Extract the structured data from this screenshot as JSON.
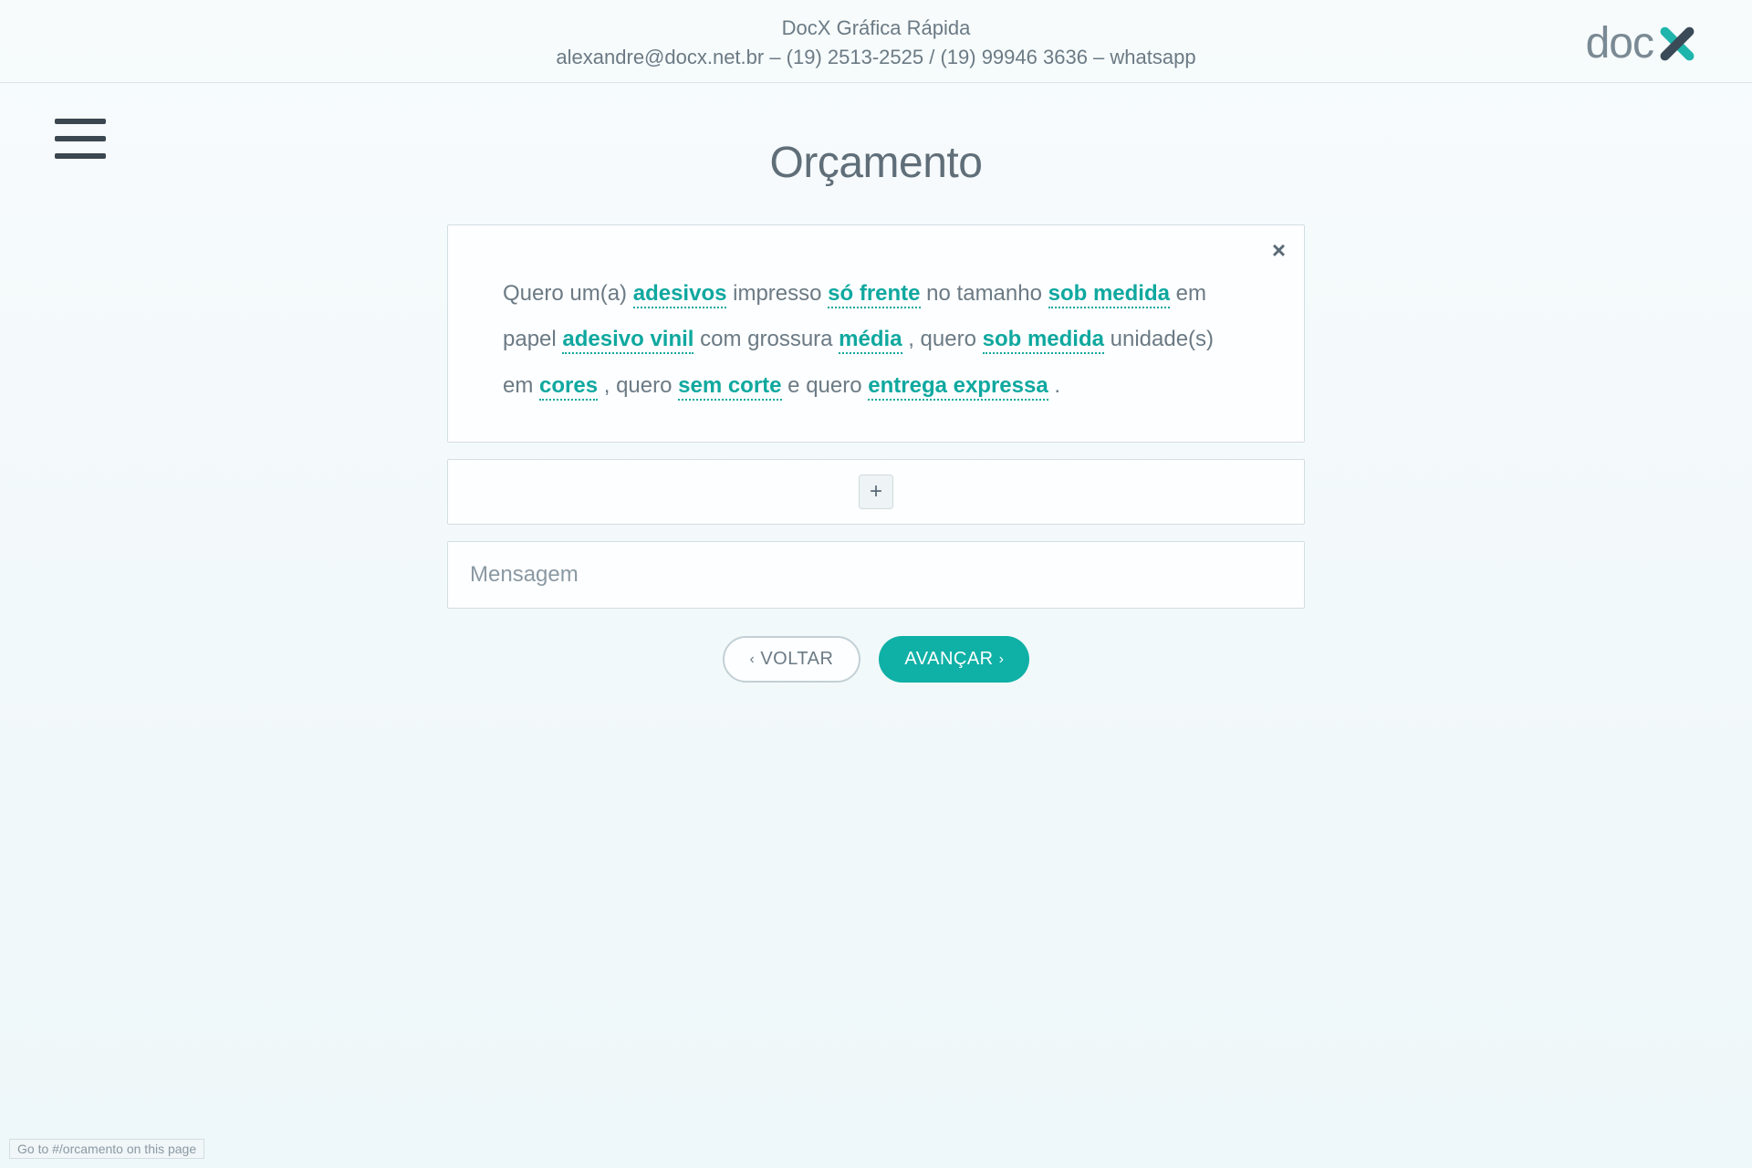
{
  "logo_text": "doc",
  "header": {
    "line1": "DocX Gráfica Rápida",
    "line2": "alexandre@docx.net.br – (19) 2513-2525 / (19) 99946 3636 – whatsapp"
  },
  "page_title": "Orçamento",
  "sentence": {
    "t0": "Quero um(a) ",
    "opt_product": "adesivos",
    "t1": " impresso ",
    "opt_sides": "só frente",
    "t2": " no tamanho ",
    "opt_size": "sob medida",
    "t3": " em papel ",
    "opt_paper": "adesivo vinil",
    "t4": " com grossura ",
    "opt_thickness": "média",
    "t5": " , quero ",
    "opt_qty": "sob medida",
    "t6": " unidade(s) em ",
    "opt_color": "cores",
    "t7": " , quero ",
    "opt_cut": "sem corte",
    "t8": " e quero ",
    "opt_delivery": "entrega expressa",
    "t9": " ."
  },
  "close_symbol": "×",
  "add_symbol": "+",
  "message_placeholder": "Mensagem",
  "buttons": {
    "back": "VOLTAR",
    "next": "AVANÇAR"
  },
  "status_text": "Go to #/orcamento on this page"
}
